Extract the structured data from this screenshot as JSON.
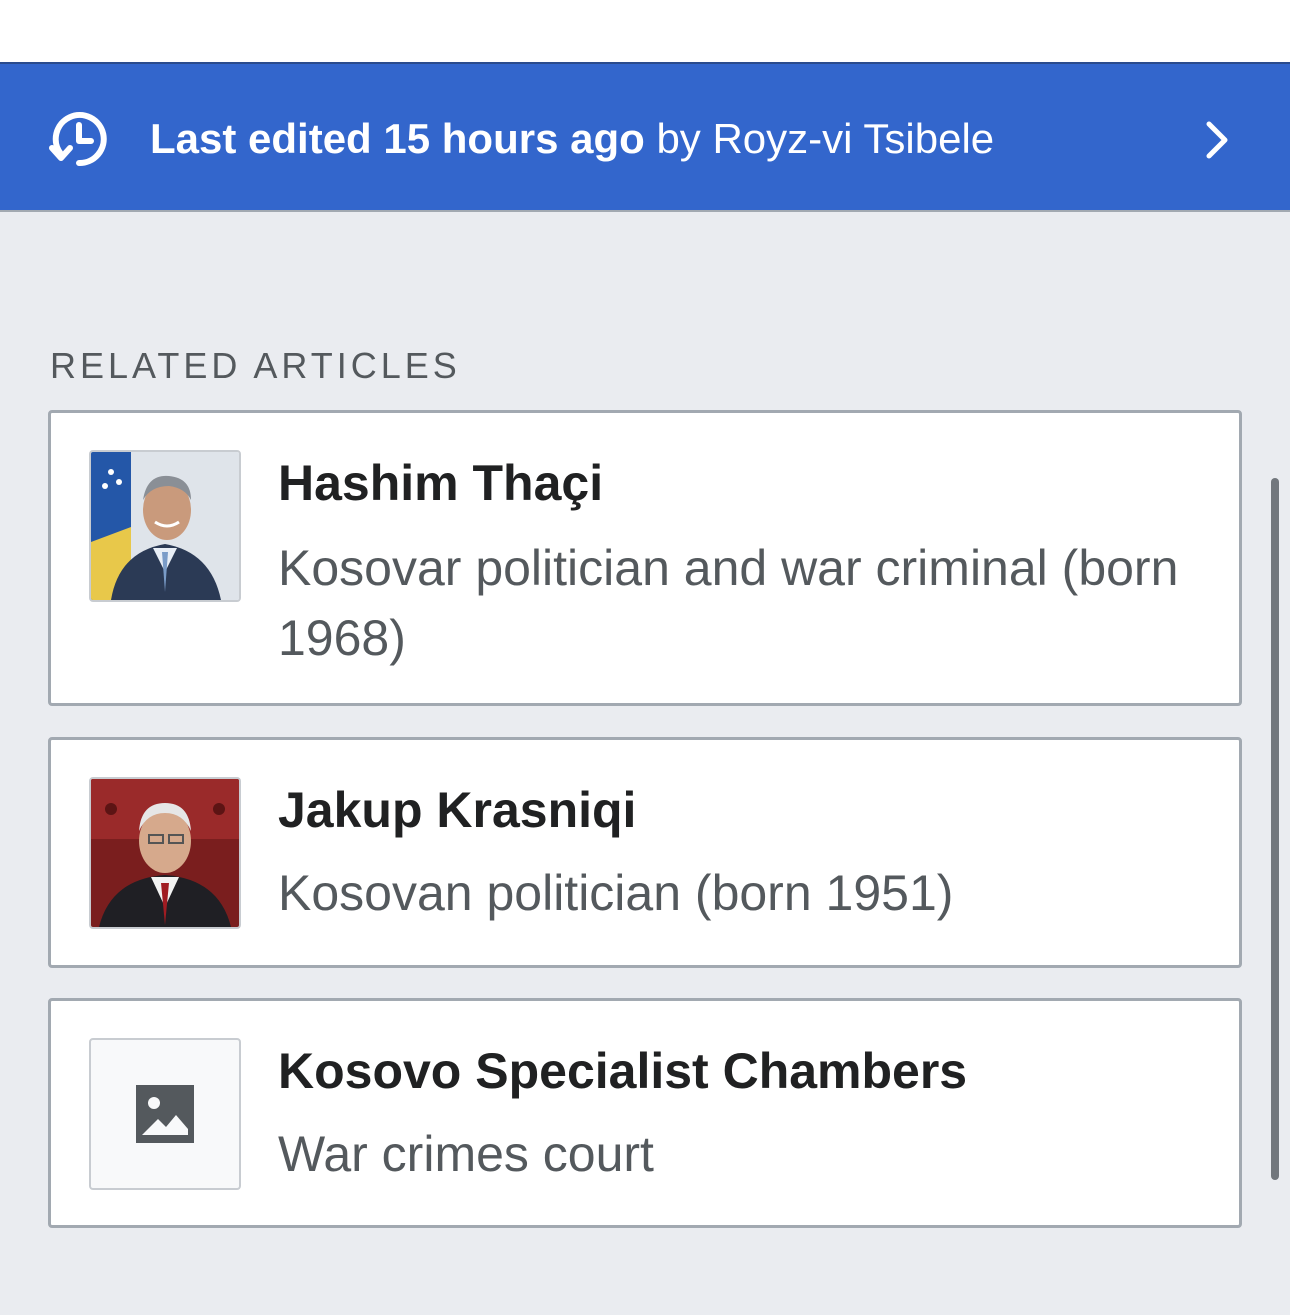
{
  "edit_banner": {
    "bold_text": "Last edited 15 hours ago",
    "by_text": " by Royz-vi Tsibele",
    "icon": "history-icon",
    "chevron": "chevron-right-icon",
    "color": "#3366cc"
  },
  "related": {
    "heading": "RELATED ARTICLES",
    "articles": [
      {
        "title": "Hashim Thaçi",
        "description": "Kosovar politician and war criminal (born 1968)",
        "thumbnail": "portrait-photo"
      },
      {
        "title": "Jakup Krasniqi",
        "description": "Kosovan politician (born 1951)",
        "thumbnail": "portrait-photo"
      },
      {
        "title": "Kosovo Specialist Chambers",
        "description": "War crimes court",
        "thumbnail": "image-placeholder-icon"
      }
    ]
  }
}
